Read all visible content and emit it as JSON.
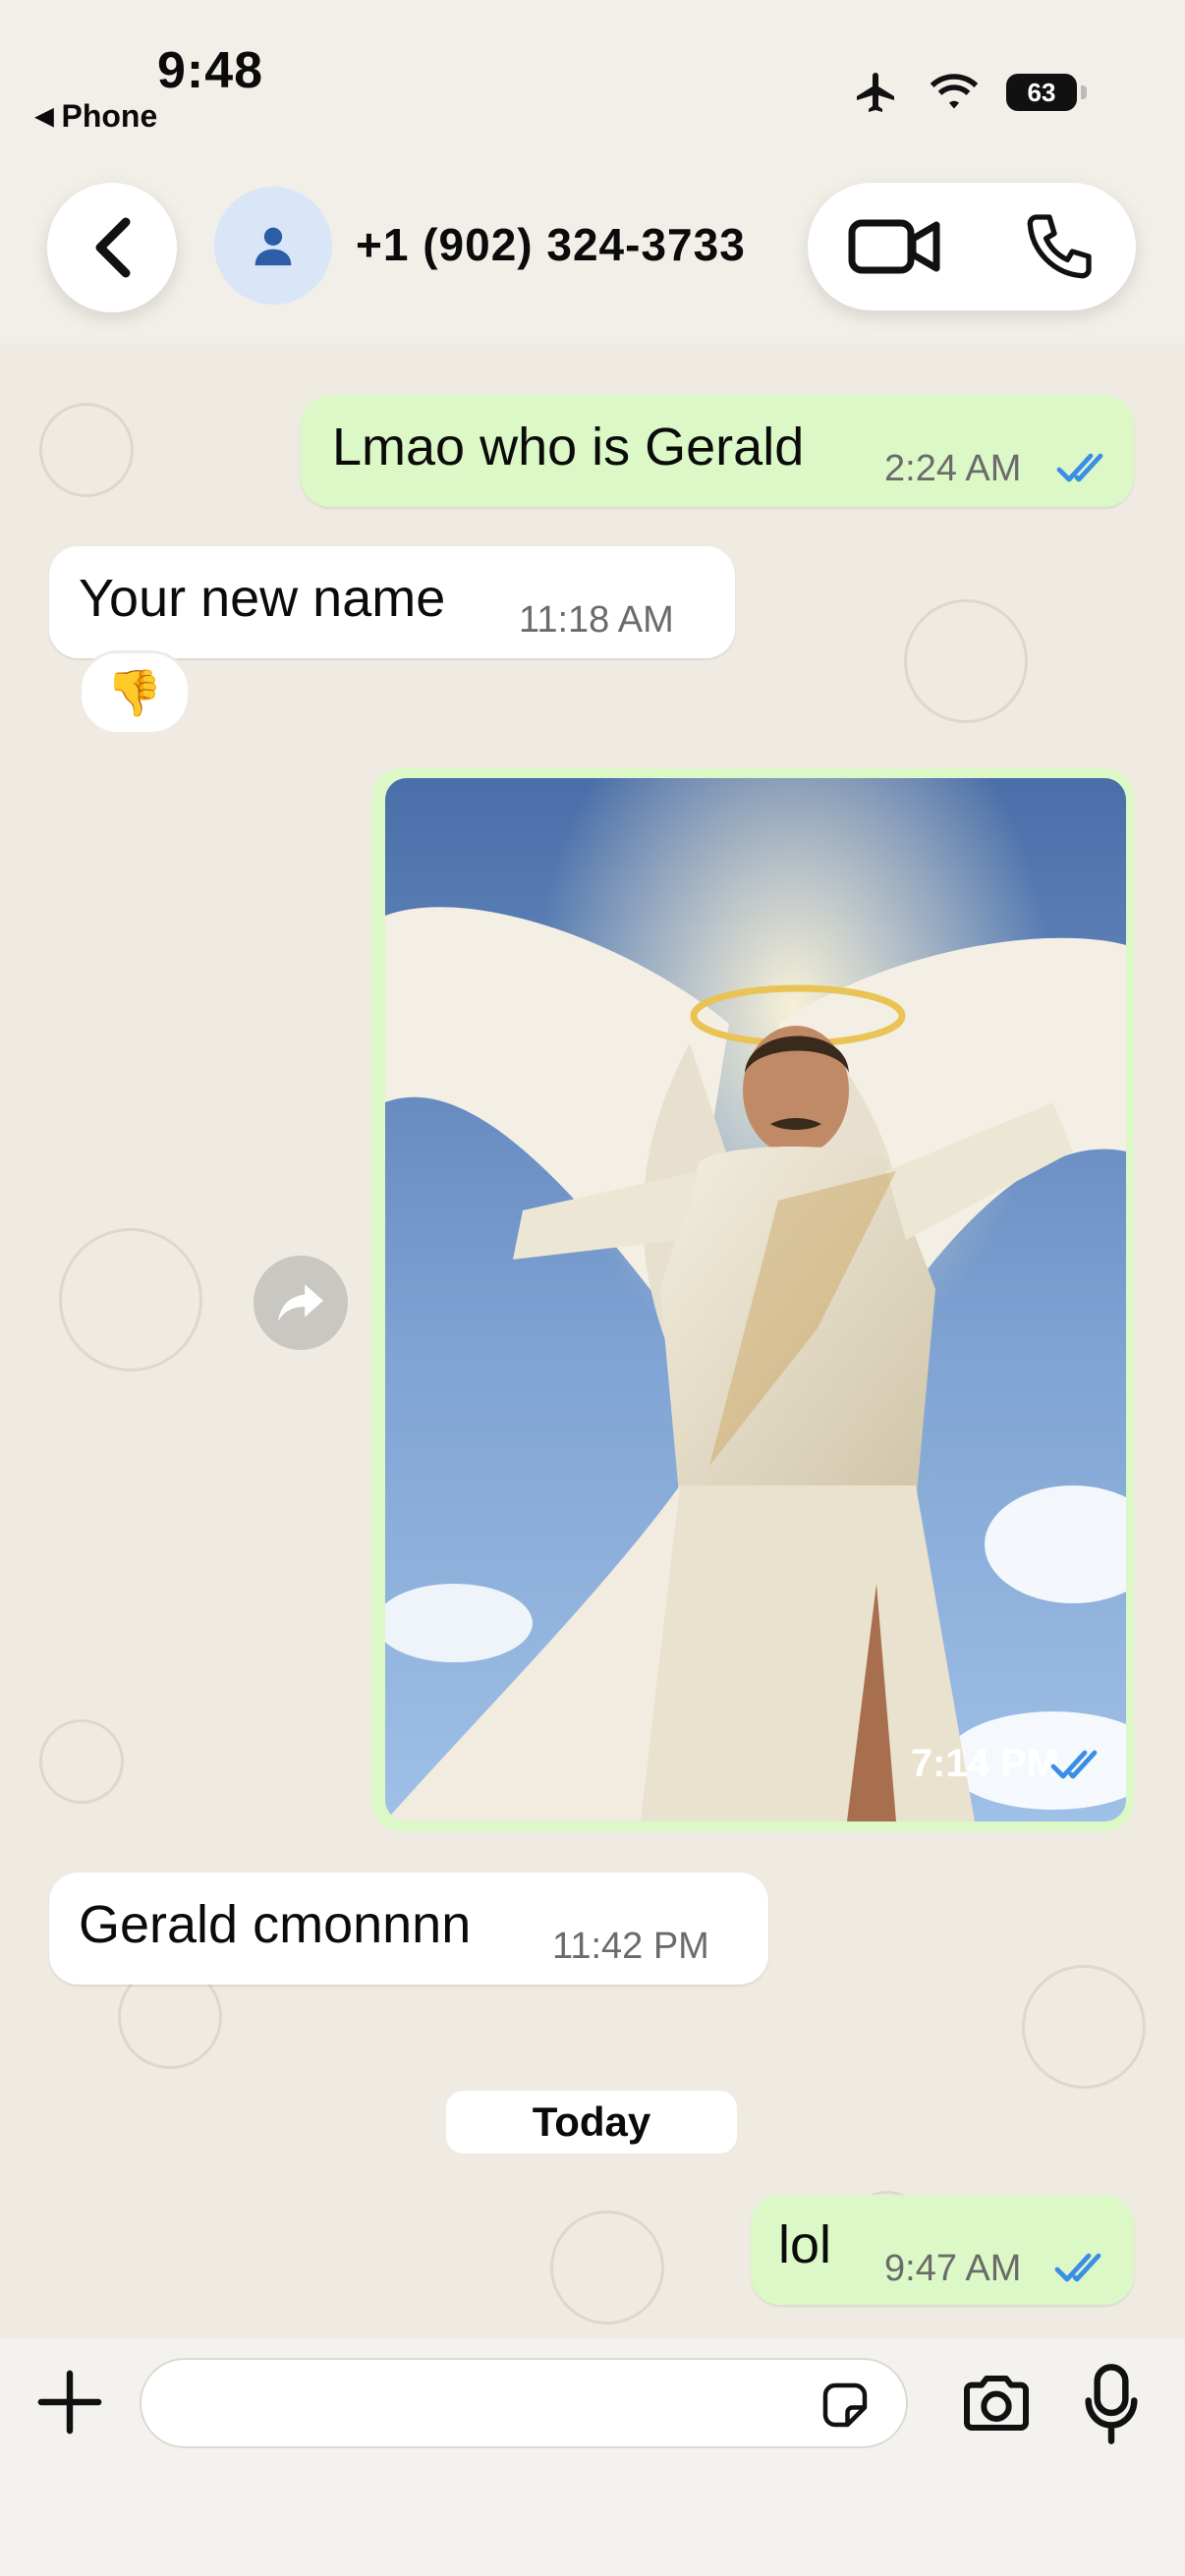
{
  "status_bar": {
    "time": "9:48",
    "back_app": "Phone",
    "battery": "63"
  },
  "header": {
    "contact": "+1 (902) 324-3733"
  },
  "messages": [
    {
      "dir": "out",
      "text": "Lmao who is Gerald",
      "time": "2:24 AM"
    },
    {
      "dir": "in",
      "text": "Your new name",
      "time": "11:18 AM",
      "reaction": "👎"
    },
    {
      "dir": "out",
      "type": "image",
      "time": "7:14 PM"
    },
    {
      "dir": "in",
      "text": "Gerald cmonnnn",
      "time": "11:42 PM"
    },
    {
      "dir": "out",
      "text": "lol",
      "time": "9:47 AM"
    }
  ],
  "date_separator": "Today",
  "composer": {
    "placeholder": ""
  },
  "colors": {
    "outgoing": "#dcf8c6",
    "incoming": "#ffffff",
    "read_ticks": "#3a8ee6",
    "chat_bg": "#efebe3"
  }
}
